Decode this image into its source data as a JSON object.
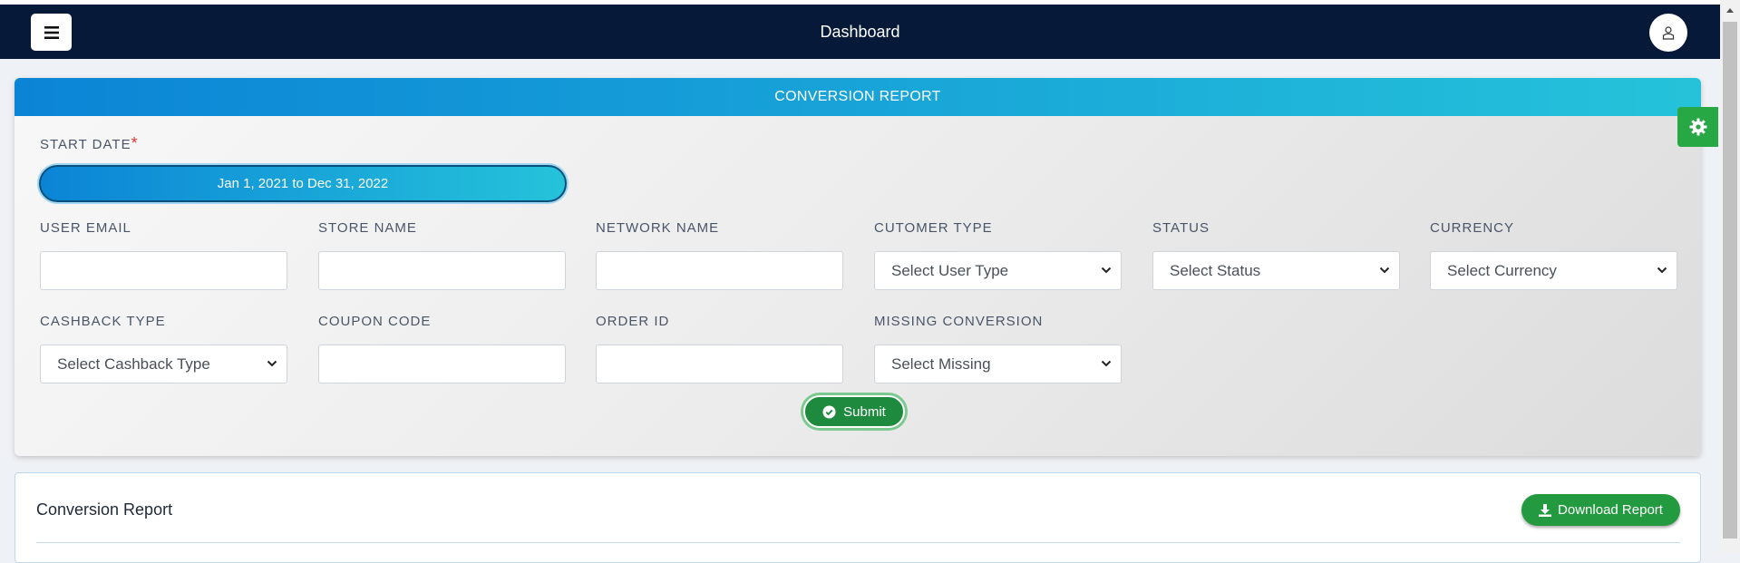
{
  "navbar": {
    "title": "Dashboard",
    "menu_icon": "hamburger-icon",
    "user_icon": "user-icon",
    "background": "#061938"
  },
  "filter_card": {
    "header": "CONVERSION REPORT",
    "start_date_label": "START DATE",
    "required_mark": "*",
    "date_range": "Jan 1, 2021 to Dec 31, 2022",
    "fields": {
      "user_email_label": "USER EMAIL",
      "user_email_value": "",
      "store_name_label": "STORE NAME",
      "store_name_value": "",
      "network_name_label": "NETWORK NAME",
      "network_name_value": "",
      "customer_type_label": "CUTOMER TYPE",
      "customer_type_selected": "Select User Type",
      "status_label": "STATUS",
      "status_selected": "Select Status",
      "currency_label": "CURRENCY",
      "currency_selected": "Select Currency",
      "cashback_type_label": "CASHBACK TYPE",
      "cashback_type_selected": "Select Cashback Type",
      "coupon_code_label": "COUPON CODE",
      "coupon_code_value": "",
      "order_id_label": "ORDER ID",
      "order_id_value": "",
      "missing_conversion_label": "MISSING CONVERSION",
      "missing_conversion_selected": "Select Missing"
    },
    "submit_label": "Submit",
    "submit_icon": "check-circle-icon"
  },
  "settings_tab": {
    "icon": "gear-icon",
    "color": "#28a745"
  },
  "report_card": {
    "title": "Conversion Report",
    "download_label": "Download Report",
    "download_icon": "download-icon"
  },
  "colors": {
    "header_gradient_start": "#0b84d6",
    "header_gradient_end": "#25c3da",
    "submit_green": "#1e8a3e",
    "download_green": "#239a3f",
    "required_red": "#e3342f"
  }
}
